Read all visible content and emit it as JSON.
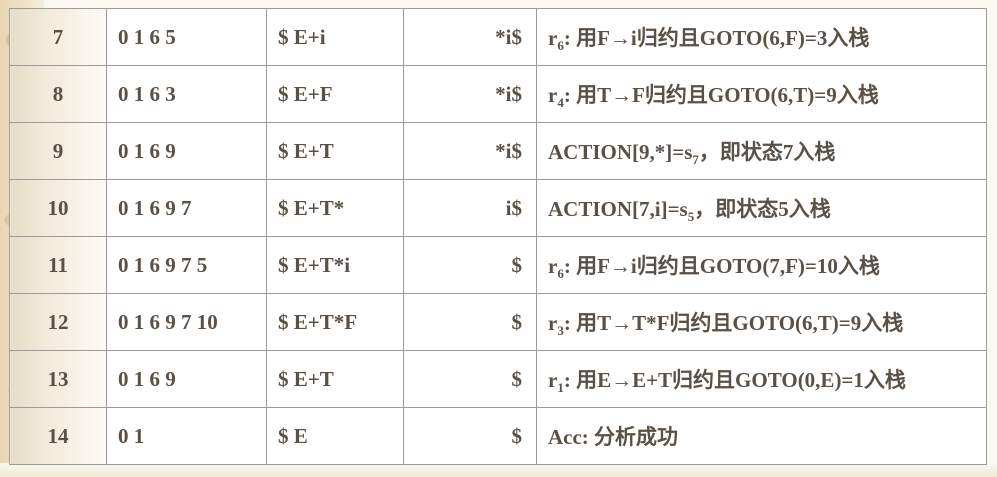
{
  "rows": [
    {
      "step": "7",
      "stack": "0 1 6 5",
      "symbols": "$ E+i",
      "input": "*i$",
      "action": {
        "pre": "r",
        "sub": "6",
        "post": ": 用F→i归约且GOTO(6,F)=3入栈"
      }
    },
    {
      "step": "8",
      "stack": "0 1 6 3",
      "symbols": "$ E+F",
      "input": "*i$",
      "action": {
        "pre": "r",
        "sub": "4",
        "post": ": 用T→F归约且GOTO(6,T)=9入栈"
      }
    },
    {
      "step": "9",
      "stack": "0 1 6 9",
      "symbols": "$ E+T",
      "input": "*i$",
      "action": {
        "pre": "ACTION[9,*]=s",
        "sub": "7",
        "post": "，即状态7入栈"
      }
    },
    {
      "step": "10",
      "stack": "0 1 6 9 7",
      "symbols": "$ E+T*",
      "input": "i$",
      "action": {
        "pre": "ACTION[7,i]=s",
        "sub": "5",
        "post": "，即状态5入栈"
      }
    },
    {
      "step": "11",
      "stack": "0 1 6 9 7 5",
      "symbols": "$ E+T*i",
      "input": "$",
      "action": {
        "pre": "r",
        "sub": "6",
        "post": ": 用F→i归约且GOTO(7,F)=10入栈"
      }
    },
    {
      "step": "12",
      "stack": "0 1 6 9 7 10",
      "symbols": "$ E+T*F",
      "input": "$",
      "action": {
        "pre": "r",
        "sub": "3",
        "post": ": 用T→T*F归约且GOTO(6,T)=9入栈"
      }
    },
    {
      "step": "13",
      "stack": "0 1 6 9",
      "symbols": "$ E+T",
      "input": "$",
      "action": {
        "pre": "r",
        "sub": "1",
        "post": ": 用E→E+T归约且GOTO(0,E)=1入栈"
      }
    },
    {
      "step": "14",
      "stack": "0 1",
      "symbols": "$ E",
      "input": "$",
      "action": {
        "pre": "Acc: 分析成功",
        "sub": "",
        "post": ""
      }
    }
  ]
}
